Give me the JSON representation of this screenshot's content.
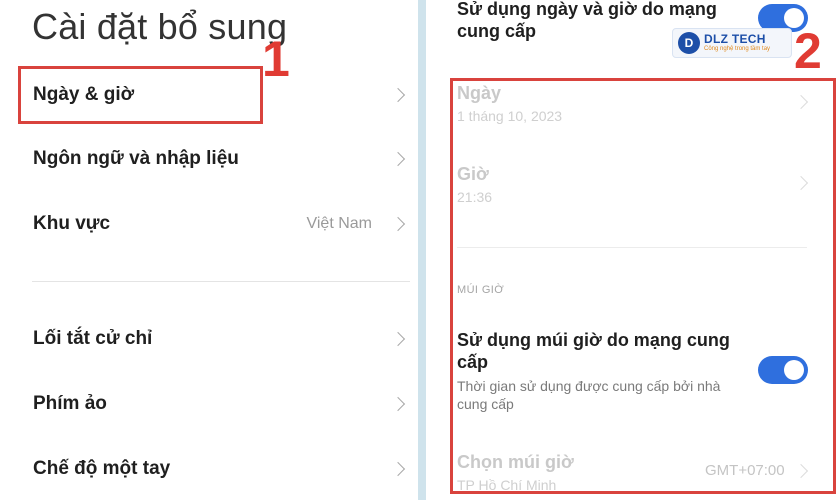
{
  "left": {
    "title": "Cài đặt bổ sung",
    "items": [
      {
        "label": "Ngày & giờ",
        "value": ""
      },
      {
        "label": "Ngôn ngữ và nhập liệu",
        "value": ""
      },
      {
        "label": "Khu vực",
        "value": "Việt Nam"
      },
      {
        "label": "Lối tắt cử chỉ",
        "value": ""
      },
      {
        "label": "Phím ảo",
        "value": ""
      },
      {
        "label": "Chế độ một tay",
        "value": ""
      }
    ],
    "step_label": "1"
  },
  "right": {
    "network_time": {
      "title_line1": "Sử dụng ngày và giờ do mạng",
      "title_line2": "cung cấp",
      "enabled": true
    },
    "date": {
      "title": "Ngày",
      "value": "1 tháng 10, 2023"
    },
    "time": {
      "title": "Giờ",
      "value": "21:36"
    },
    "timezone_header": "MÚI GIỜ",
    "network_timezone": {
      "title_line1": "Sử dụng múi giờ do mạng cung",
      "title_line2": "cấp",
      "subtitle_line1": "Thời gian sử dụng được cung cấp bởi nhà",
      "subtitle_line2": "cung cấp",
      "enabled": true
    },
    "choose_timezone": {
      "title": "Chọn múi giờ",
      "subtitle": "TP Hồ Chí Minh",
      "value": "GMT+07:00"
    },
    "step_label": "2"
  },
  "watermark": {
    "name": "DLZ TECH",
    "mark": "D",
    "tagline": "Công nghệ trong tầm tay"
  },
  "colors": {
    "accent": "#2f6fde",
    "highlight": "#d9433d",
    "step": "#e03b33"
  }
}
